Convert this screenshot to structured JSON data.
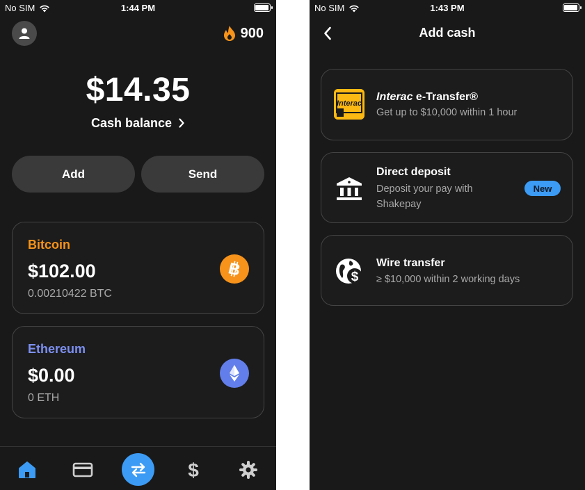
{
  "colors": {
    "background": "#191919",
    "card_border": "#444444",
    "bitcoin": "#F7931A",
    "ethereum": "#627EEA",
    "accent_blue": "#3C9BF4",
    "streak": "#F7931A",
    "interac": "#FDB913"
  },
  "left_screen": {
    "status": {
      "carrier": "No SIM",
      "time": "1:44 PM",
      "battery_level": 1.0
    },
    "header": {
      "avatar_icon": "person-icon",
      "streak_icon": "flame-icon",
      "streak_count": "900"
    },
    "balance": {
      "amount": "$14.35",
      "label": "Cash balance",
      "chevron": "›"
    },
    "actions": {
      "add_label": "Add",
      "send_label": "Send"
    },
    "assets": [
      {
        "name": "Bitcoin",
        "value": "$102.00",
        "quantity": "0.00210422 BTC",
        "icon": "bitcoin-icon"
      },
      {
        "name": "Ethereum",
        "value": "$0.00",
        "quantity": "0 ETH",
        "icon": "ethereum-icon"
      }
    ],
    "tabbar": {
      "tabs": [
        "home-icon",
        "card-icon",
        "swap-icon",
        "dollar-icon",
        "gear-icon"
      ],
      "active": "home-icon"
    }
  },
  "right_screen": {
    "status": {
      "carrier": "No SIM",
      "time": "1:43 PM",
      "battery_level": 1.0
    },
    "nav": {
      "back_icon": "chevron-left-icon",
      "title": "Add cash"
    },
    "options": [
      {
        "title_italic": "Interac",
        "title_rest": " e-Transfer®",
        "subtitle": "Get up to $10,000 within 1 hour",
        "icon": "interac-logo",
        "logo_text": "Interac"
      },
      {
        "title": "Direct deposit",
        "subtitle": "Deposit your pay with Shakepay",
        "badge": "New",
        "icon": "bank-icon"
      },
      {
        "title": "Wire transfer",
        "subtitle": "≥ $10,000 within 2 working days",
        "icon": "globe-dollar-icon"
      }
    ]
  }
}
